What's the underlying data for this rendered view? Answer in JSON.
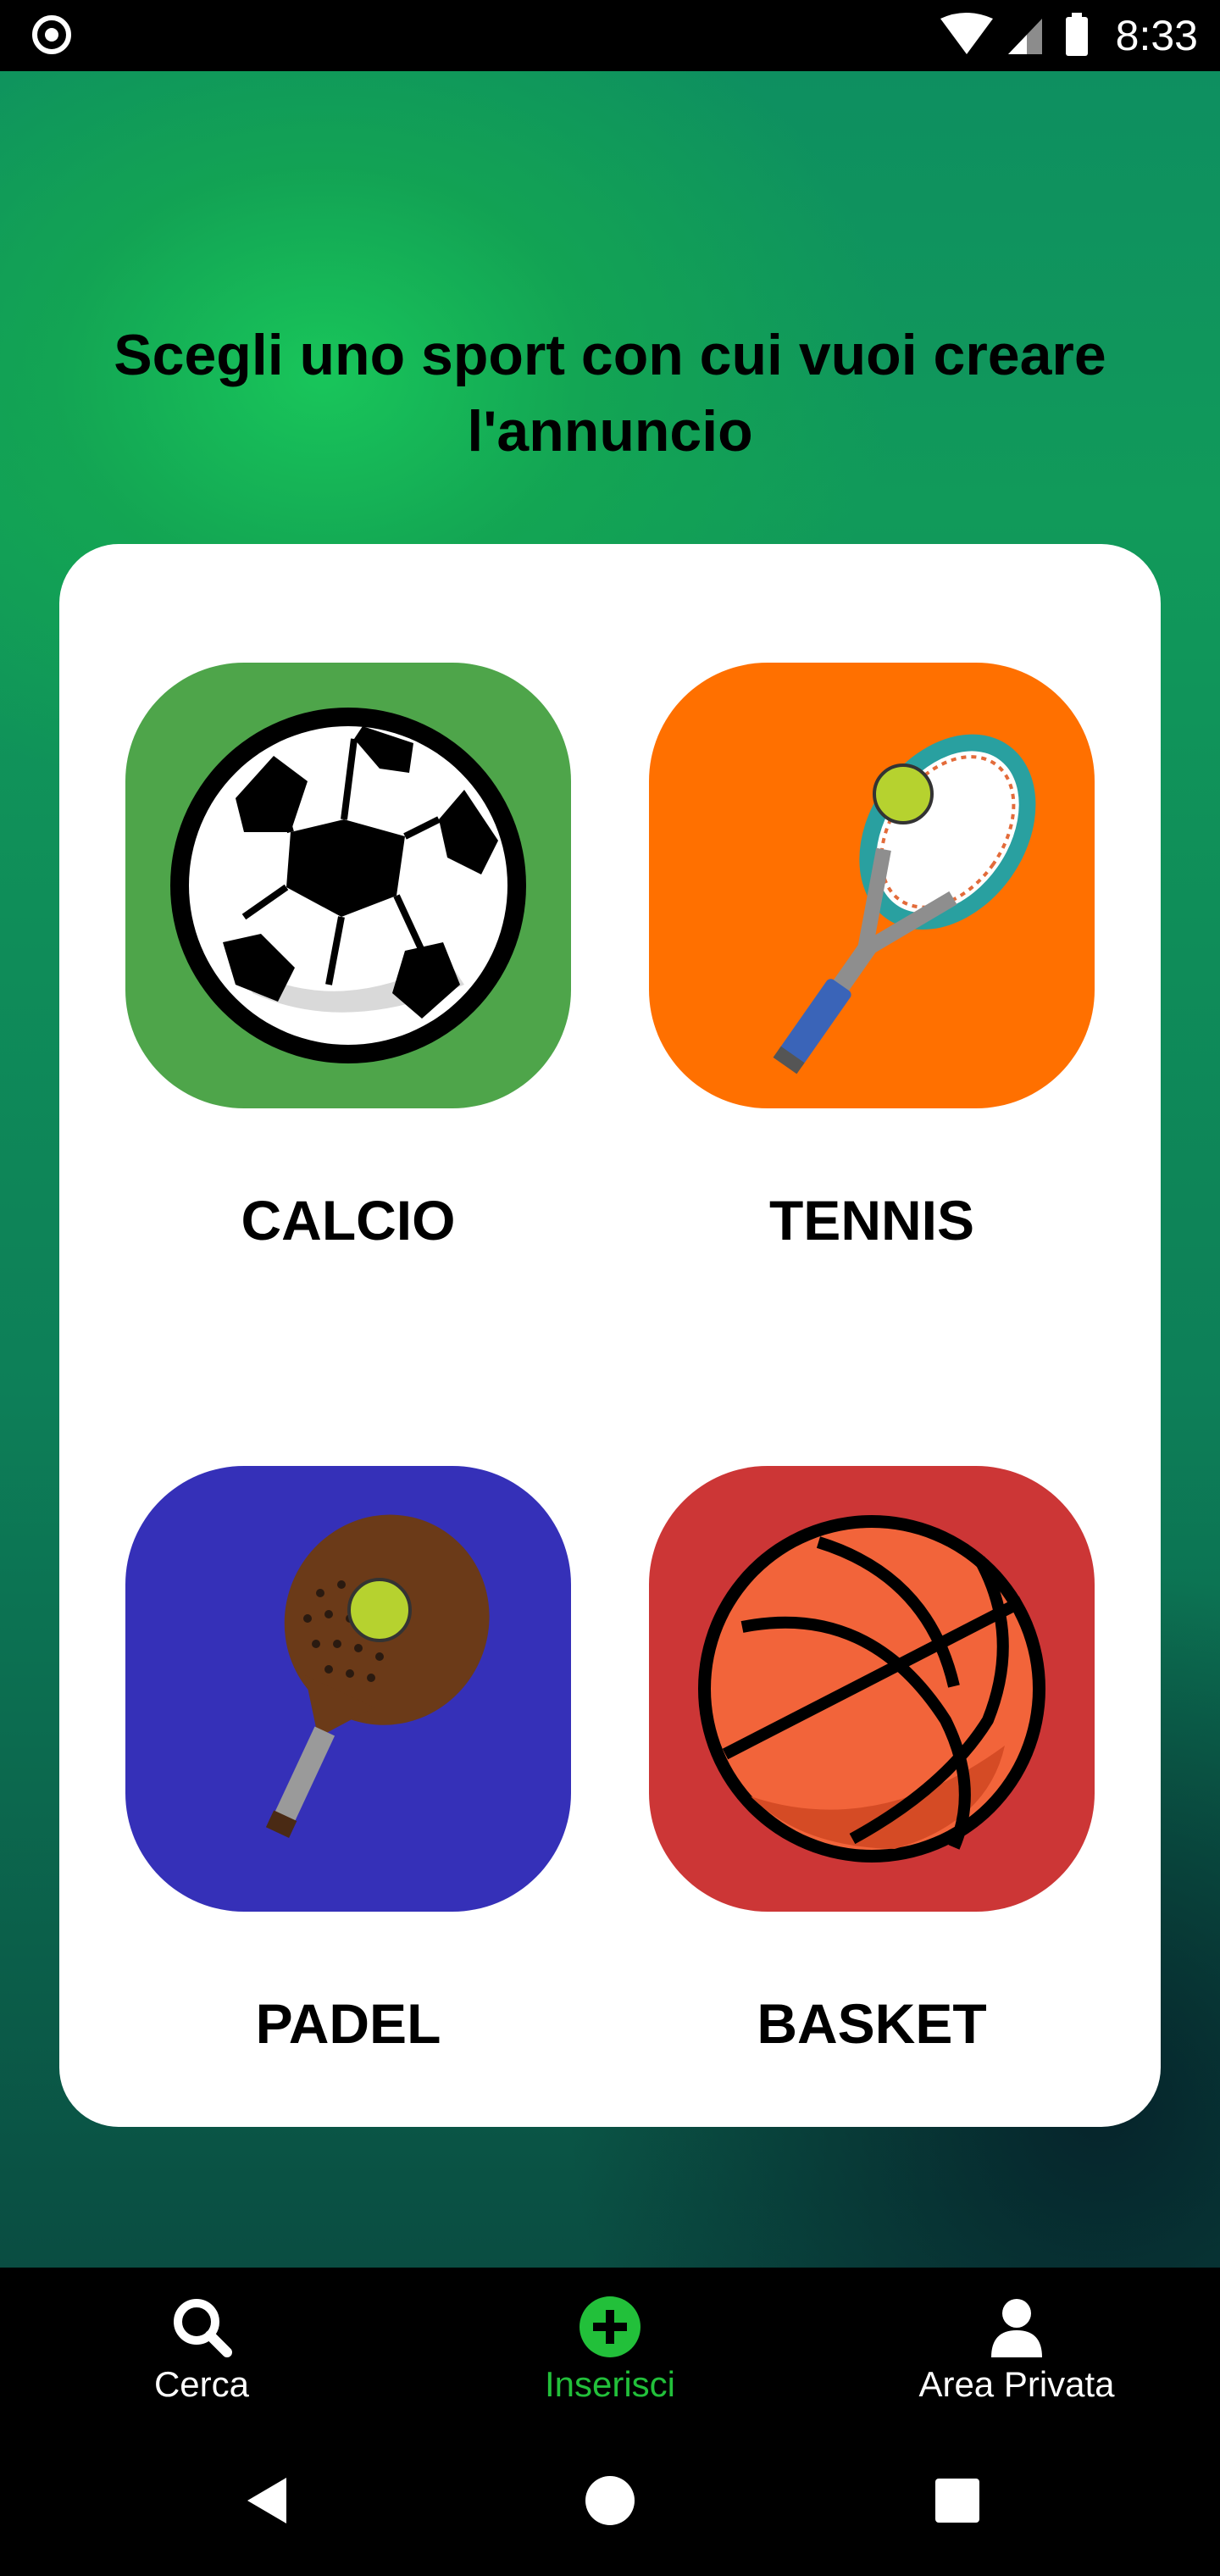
{
  "status_bar": {
    "time": "8:33"
  },
  "heading": "Scegli uno sport con cui vuoi creare l'annuncio",
  "sports": [
    {
      "label": "CALCIO",
      "color": "#4ea54a",
      "icon": "soccer-ball-icon"
    },
    {
      "label": "TENNIS",
      "color": "#ff7000",
      "icon": "tennis-racket-icon"
    },
    {
      "label": "PADEL",
      "color": "#3530b8",
      "icon": "padel-racket-icon"
    },
    {
      "label": "BASKET",
      "color": "#cc3636",
      "icon": "basketball-icon"
    }
  ],
  "bottom_nav": {
    "items": [
      {
        "label": "Cerca",
        "icon": "search-icon",
        "active": false
      },
      {
        "label": "Inserisci",
        "icon": "add-circle-icon",
        "active": true
      },
      {
        "label": "Area Privata",
        "icon": "user-icon",
        "active": false
      }
    ],
    "active_color": "#22c03a"
  }
}
